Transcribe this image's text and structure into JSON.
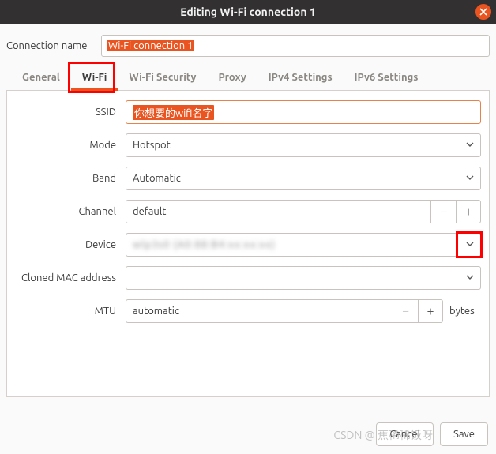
{
  "window": {
    "title": "Editing Wi-Fi connection 1"
  },
  "connection": {
    "label": "Connection name",
    "value": "Wi-Fi connection 1"
  },
  "tabs": {
    "general": "General",
    "wifi": "Wi-Fi",
    "security": "Wi-Fi Security",
    "proxy": "Proxy",
    "ipv4": "IPv4 Settings",
    "ipv6": "IPv6 Settings"
  },
  "form": {
    "ssid": {
      "label": "SSID",
      "value": "你想要的wifi名字"
    },
    "mode": {
      "label": "Mode",
      "value": "Hotspot"
    },
    "band": {
      "label": "Band",
      "value": "Automatic"
    },
    "channel": {
      "label": "Channel",
      "value": "default"
    },
    "device": {
      "label": "Device",
      "value": "wlp3s0 (A0:88:B4:xx:xx:xx)"
    },
    "clonedmac": {
      "label": "Cloned MAC address",
      "value": ""
    },
    "mtu": {
      "label": "MTU",
      "value": "automatic",
      "unit": "bytes"
    }
  },
  "footer": {
    "cancel": "Cancel",
    "save": "Save"
  },
  "watermark": "CSDN @ 蕉稀稀饭呀"
}
